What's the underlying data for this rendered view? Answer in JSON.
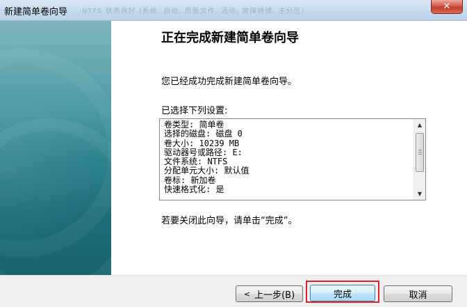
{
  "window": {
    "title": "新建简单卷向导",
    "title_ghost": "NTFS    状态良好 (系统, 启动, 页面文件, 活动, 故障转储, 主分区)",
    "close_symbol": "✕"
  },
  "content": {
    "heading": "正在完成新建简单卷向导",
    "intro": "您已经成功完成新建简单卷向导。",
    "settings_label": "已选择下列设置:",
    "settings": [
      "卷类型: 简单卷",
      "选择的磁盘: 磁盘 0",
      "卷大小: 10239 MB",
      "驱动器号或路径: E:",
      "文件系统: NTFS",
      "分配单元大小: 默认值",
      "卷标: 新加卷",
      "快速格式化: 是"
    ],
    "close_hint": "若要关闭此向导，请单击“完成”。"
  },
  "buttons": {
    "back_arrow": "<",
    "back_label": "上一步(B)",
    "finish_label": "完成",
    "cancel_label": "取消"
  },
  "colors": {
    "highlight": "#e0232a",
    "panel": "#2f828b"
  }
}
